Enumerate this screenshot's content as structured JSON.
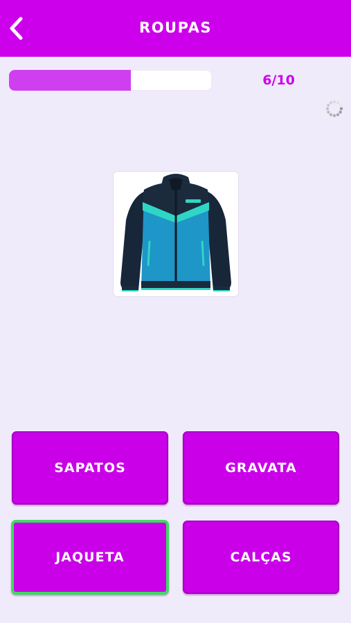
{
  "header": {
    "title": "ROUPAS",
    "back_icon": "chevron-left-icon",
    "color": "#cc00ea"
  },
  "progress": {
    "counter": "6/10",
    "fraction": 0.6,
    "fill_color": "#cf3ff0"
  },
  "status": {
    "spinner_icon": "loading-spinner-icon"
  },
  "question": {
    "image_icon": "jacket-image"
  },
  "answers": [
    {
      "label": "SAPATOS",
      "selected": false
    },
    {
      "label": "GRAVATA",
      "selected": false
    },
    {
      "label": "JAQUETA",
      "selected": true
    },
    {
      "label": "CALÇAS",
      "selected": false
    }
  ],
  "colors": {
    "button": "#c900e8",
    "selected_border": "#3ddc5f",
    "background": "#f0ebfb"
  }
}
